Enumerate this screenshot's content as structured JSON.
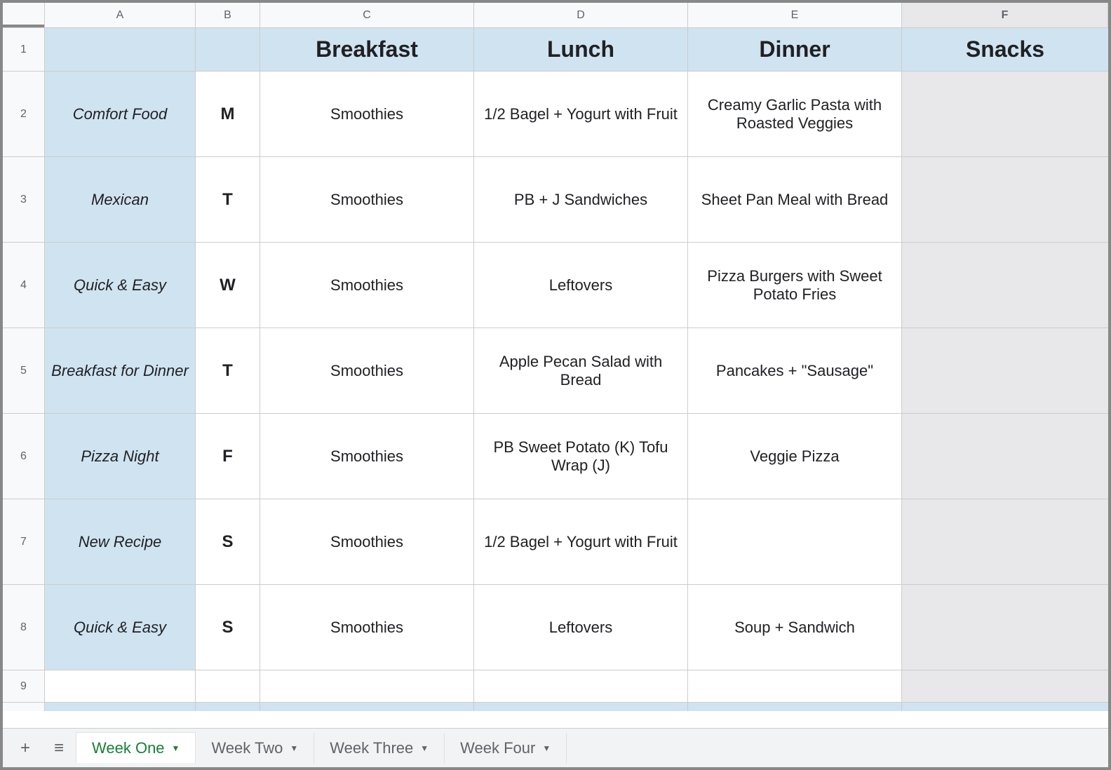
{
  "columns": [
    "A",
    "B",
    "C",
    "D",
    "E",
    "F"
  ],
  "rowNumbers": [
    "1",
    "2",
    "3",
    "4",
    "5",
    "6",
    "7",
    "8",
    "9"
  ],
  "headerRow": {
    "A": "",
    "B": "",
    "C": "Breakfast",
    "D": "Lunch",
    "E": "Dinner",
    "F": "Snacks"
  },
  "dataRows": [
    {
      "A": "Comfort Food",
      "B": "M",
      "C": "Smoothies",
      "D": "1/2 Bagel + Yogurt with Fruit",
      "E": "Creamy Garlic Pasta with Roasted Veggies",
      "F": ""
    },
    {
      "A": "Mexican",
      "B": "T",
      "C": "Smoothies",
      "D": "PB + J Sandwiches",
      "E": "Sheet Pan Meal with Bread",
      "F": ""
    },
    {
      "A": "Quick & Easy",
      "B": "W",
      "C": "Smoothies",
      "D": "Leftovers",
      "E": "Pizza Burgers with Sweet Potato Fries",
      "F": ""
    },
    {
      "A": "Breakfast for Dinner",
      "B": "T",
      "C": "Smoothies",
      "D": "Apple Pecan Salad with Bread",
      "E": "Pancakes + \"Sausage\"",
      "F": ""
    },
    {
      "A": "Pizza Night",
      "B": "F",
      "C": "Smoothies",
      "D": "PB Sweet Potato (K) Tofu Wrap (J)",
      "E": "Veggie Pizza",
      "F": ""
    },
    {
      "A": "New Recipe",
      "B": "S",
      "C": "Smoothies",
      "D": "1/2 Bagel + Yogurt with Fruit",
      "E": "",
      "F": ""
    },
    {
      "A": "Quick & Easy",
      "B": "S",
      "C": "Smoothies",
      "D": "Leftovers",
      "E": "Soup + Sandwich",
      "F": ""
    }
  ],
  "tabs": {
    "addIcon": "+",
    "menuIcon": "≡",
    "items": [
      {
        "label": "Week One",
        "active": true
      },
      {
        "label": "Week Two",
        "active": false
      },
      {
        "label": "Week Three",
        "active": false
      },
      {
        "label": "Week Four",
        "active": false
      }
    ]
  }
}
